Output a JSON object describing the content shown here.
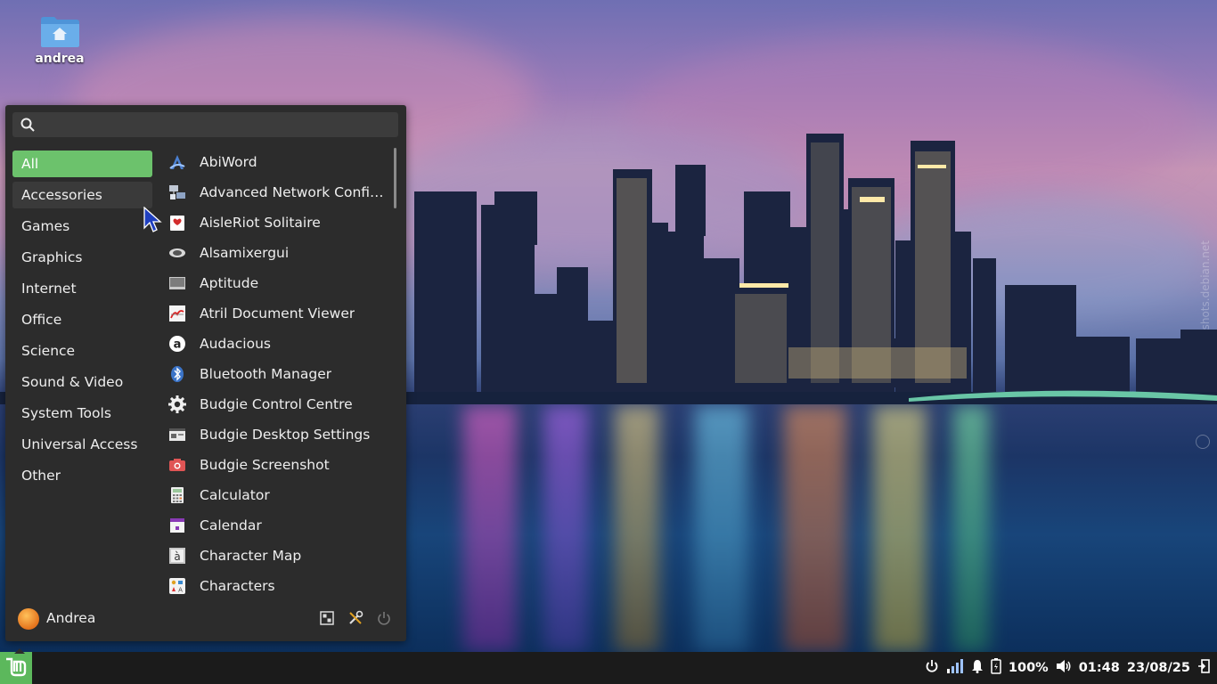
{
  "desktop": {
    "home_icon_label": "andrea",
    "watermark": "shots.debian.net"
  },
  "menu": {
    "search": {
      "placeholder": "",
      "value": ""
    },
    "categories": [
      "All",
      "Accessories",
      "Games",
      "Graphics",
      "Internet",
      "Office",
      "Science",
      "Sound & Video",
      "System Tools",
      "Universal Access",
      "Other"
    ],
    "apps": [
      {
        "label": "AbiWord",
        "icon": "abiword-icon"
      },
      {
        "label": "Advanced Network Configur…",
        "icon": "network-config-icon"
      },
      {
        "label": "AisleRiot Solitaire",
        "icon": "solitaire-icon"
      },
      {
        "label": "Alsamixergui",
        "icon": "mixer-icon"
      },
      {
        "label": "Aptitude",
        "icon": "aptitude-icon"
      },
      {
        "label": "Atril Document Viewer",
        "icon": "document-viewer-icon"
      },
      {
        "label": "Audacious",
        "icon": "audacious-icon"
      },
      {
        "label": "Bluetooth Manager",
        "icon": "bluetooth-icon"
      },
      {
        "label": "Budgie Control Centre",
        "icon": "gear-icon"
      },
      {
        "label": "Budgie Desktop Settings",
        "icon": "desktop-settings-icon"
      },
      {
        "label": "Budgie Screenshot",
        "icon": "camera-icon"
      },
      {
        "label": "Calculator",
        "icon": "calculator-icon"
      },
      {
        "label": "Calendar",
        "icon": "calendar-icon"
      },
      {
        "label": "Character Map",
        "icon": "character-map-icon"
      },
      {
        "label": "Characters",
        "icon": "characters-icon"
      }
    ],
    "user": {
      "name": "Andrea"
    }
  },
  "panel": {
    "battery": "100%",
    "time": "01:48",
    "date": "23/08/25"
  },
  "colors": {
    "accent": "#6cc26c",
    "menu_bg": "#2c2c2c",
    "panel_bg": "#1b1b1b",
    "mint_green": "#5cb85c"
  }
}
